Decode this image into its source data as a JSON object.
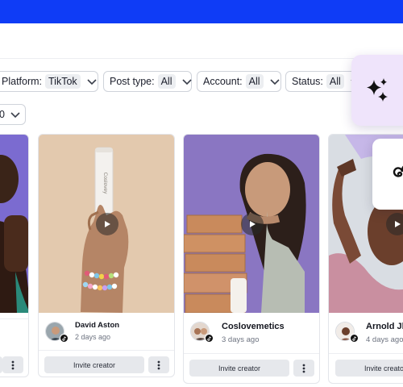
{
  "filters": {
    "platform": {
      "label": "Platform:",
      "value": "TikTok"
    },
    "post_type": {
      "label": "Post type:",
      "value": "All"
    },
    "account": {
      "label": "Account:",
      "value": "All"
    },
    "status": {
      "label": "Status:",
      "value": "All"
    }
  },
  "sort_select": {
    "value": "0"
  },
  "cards": [
    {
      "name": "",
      "time": "",
      "invite_label": ""
    },
    {
      "name": "David Aston",
      "time": "2 days ago",
      "invite_label": "Invite creator"
    },
    {
      "name": "Coslovemetics",
      "time": "3 days ago",
      "invite_label": "Invite creator"
    },
    {
      "name": "Arnold Jl",
      "time": "4 days ago",
      "invite_label": "Invite creator"
    }
  ],
  "product_text": "Coslovey",
  "colors": {
    "topbar": "#0f3cf6",
    "ai_panel": "#efe4fb",
    "button_bg": "#e6e8ec"
  },
  "icons": {
    "ai": "sparkles-icon",
    "spiral": "spiral-icon",
    "play": "play-icon",
    "more": "more-vertical-icon",
    "tiktok": "tiktok-icon",
    "dropdown": "chevron-down-icon"
  }
}
